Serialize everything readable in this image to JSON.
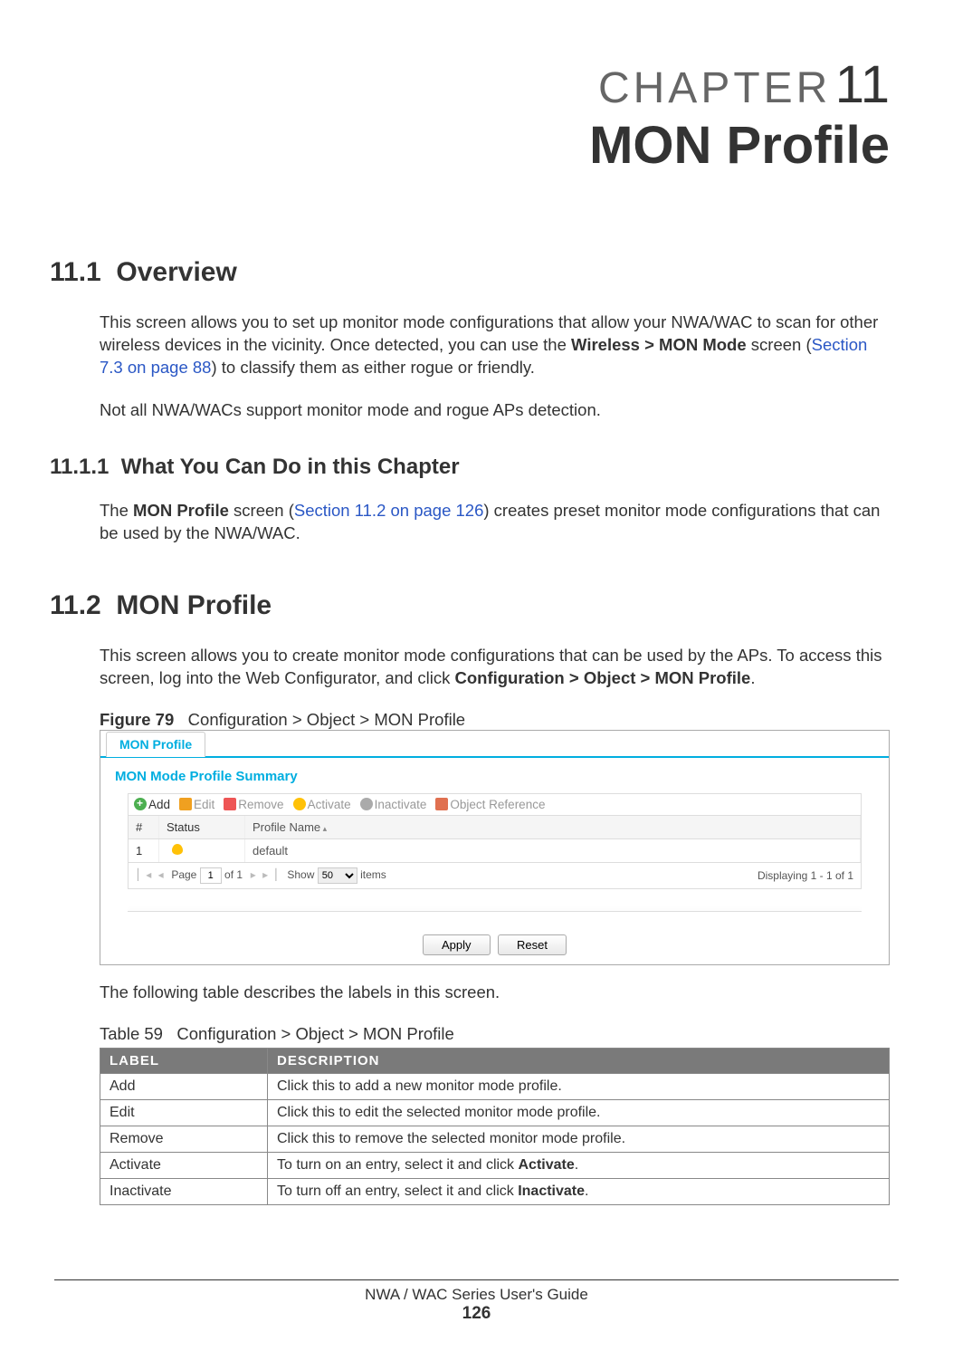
{
  "chapter": {
    "label": "CHAPTER",
    "number": "11",
    "title": "MON Profile"
  },
  "sections": {
    "s11_1": {
      "num": "11.1",
      "title": "Overview"
    },
    "s11_1_1": {
      "num": "11.1.1",
      "title": "What You Can Do in this Chapter"
    },
    "s11_2": {
      "num": "11.2",
      "title": "MON Profile"
    }
  },
  "paragraphs": {
    "p1a": "This screen allows you to set up monitor mode configurations that allow your NWA/WAC to scan for other wireless devices in the vicinity. Once detected, you can use the ",
    "p1_bold": "Wireless > MON Mode",
    "p1b": " screen (",
    "p1_link": "Section 7.3 on page 88",
    "p1c": ") to classify them as either rogue or friendly.",
    "p2": "Not all NWA/WACs support monitor mode and rogue APs detection.",
    "p3a": "The ",
    "p3_bold": "MON Profile",
    "p3b": " screen (",
    "p3_link": "Section 11.2 on page 126",
    "p3c": ") creates preset monitor mode configurations that can be used by the NWA/WAC.",
    "p4a": "This screen allows you to create monitor mode configurations that can be used by the APs. To access this screen, log into the Web Configurator, and click ",
    "p4_bold": "Configuration > Object > MON Profile",
    "p4b": ".",
    "p5": "The following table describes the labels in this screen."
  },
  "figure": {
    "label": "Figure 79",
    "caption": "Configuration > Object > MON Profile"
  },
  "screenshot": {
    "tab": "MON Profile",
    "summary": "MON Mode Profile Summary",
    "toolbar": {
      "add": "Add",
      "edit": "Edit",
      "remove": "Remove",
      "activate": "Activate",
      "inactivate": "Inactivate",
      "objref": "Object Reference"
    },
    "columns": {
      "num": "#",
      "status": "Status",
      "name": "Profile Name"
    },
    "rows": [
      {
        "num": "1",
        "name": "default"
      }
    ],
    "pager": {
      "page_label": "Page",
      "page_value": "1",
      "of_label": "of 1",
      "show_label": "Show",
      "show_value": "50",
      "items_label": "items",
      "display": "Displaying 1 - 1 of 1"
    },
    "buttons": {
      "apply": "Apply",
      "reset": "Reset"
    }
  },
  "table": {
    "label": "Table 59",
    "caption": "Configuration > Object > MON Profile",
    "head": {
      "label": "LABEL",
      "desc": "DESCRIPTION"
    },
    "rows": [
      {
        "label": "Add",
        "desc": "Click this to add a new monitor mode profile."
      },
      {
        "label": "Edit",
        "desc": "Click this to edit the selected monitor mode profile."
      },
      {
        "label": "Remove",
        "desc": "Click this to remove the selected monitor mode profile."
      },
      {
        "label": "Activate",
        "desc_a": "To turn on an entry, select it and click ",
        "desc_bold": "Activate",
        "desc_b": "."
      },
      {
        "label": "Inactivate",
        "desc_a": "To turn off an entry, select it and click ",
        "desc_bold": "Inactivate",
        "desc_b": "."
      }
    ]
  },
  "footer": {
    "guide": "NWA / WAC Series User's Guide",
    "page": "126"
  }
}
